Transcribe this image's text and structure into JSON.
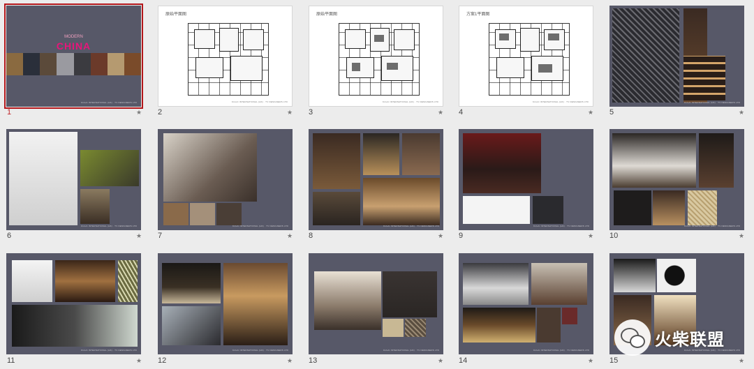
{
  "slides": [
    {
      "num": "1"
    },
    {
      "num": "2",
      "plan_title": "原始平面图"
    },
    {
      "num": "3",
      "plan_title": "原始平面图"
    },
    {
      "num": "4",
      "plan_title": "方案1平面图"
    },
    {
      "num": "5"
    },
    {
      "num": "6"
    },
    {
      "num": "7"
    },
    {
      "num": "8"
    },
    {
      "num": "9"
    },
    {
      "num": "10"
    },
    {
      "num": "11"
    },
    {
      "num": "12"
    },
    {
      "num": "13"
    },
    {
      "num": "14"
    },
    {
      "num": "15"
    }
  ],
  "cover": {
    "subtitle": "MODERN",
    "title": "CHINA"
  },
  "footer_text": "KULAI INTERNATIONAL (HK) · TV DESIGNERS LTD",
  "star_glyph": "★",
  "watermark": {
    "text": "火柴联盟",
    "icon": "wechat-icon"
  },
  "colors": {
    "accent": "#e8157a",
    "selection": "#b3161a",
    "slide_bg": "#575868"
  }
}
